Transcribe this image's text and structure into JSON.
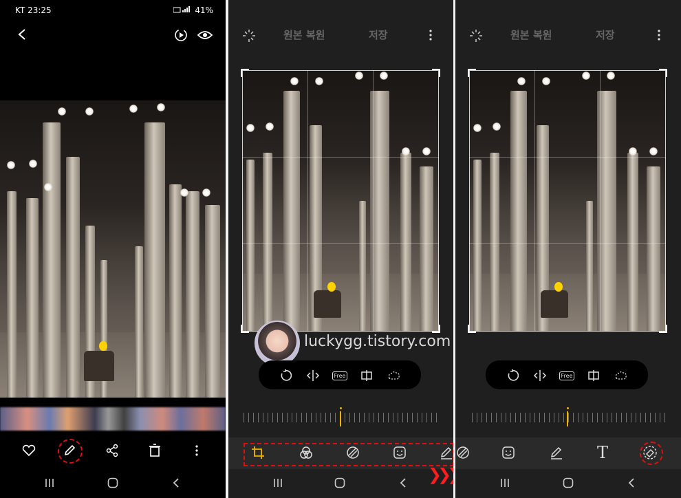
{
  "status_bar": {
    "carrier_time": "KT 23:25",
    "right": "41%"
  },
  "panel1": {
    "bottom_actions": [
      "heart-icon",
      "pencil-icon",
      "share-icon",
      "trash-icon",
      "more-icon"
    ]
  },
  "editor": {
    "revert_label": "원본 복원",
    "save_label": "저장",
    "free_label": "Free"
  },
  "watermark": {
    "text": "luckygg.tistory.com"
  },
  "panel3": {
    "text_tool_label": "T"
  },
  "accent": {
    "highlight": "#e01010",
    "active": "#f0b400"
  }
}
